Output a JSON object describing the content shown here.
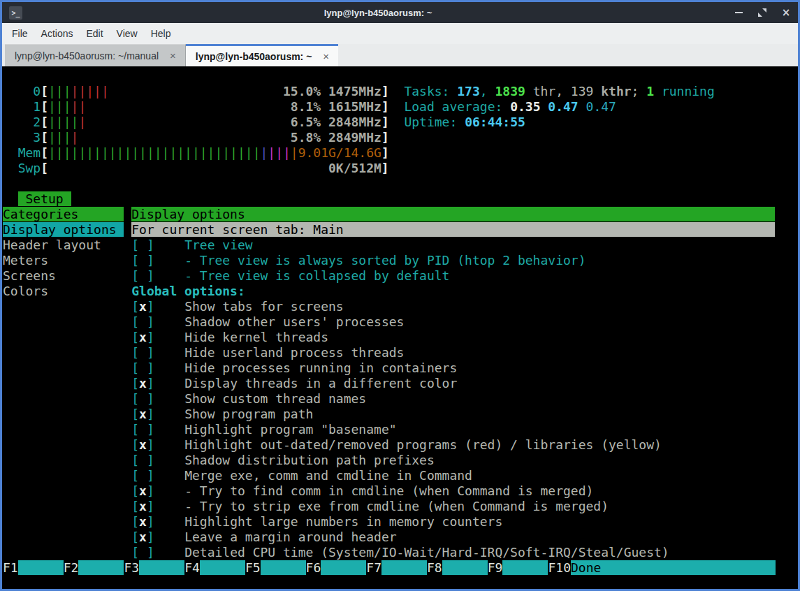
{
  "window": {
    "title": "lynp@lyn-b450aorusm: ~",
    "buttons": [
      "minimize",
      "restore",
      "close"
    ]
  },
  "glyphs": {
    "terminal_icon": ">_",
    "close": "×"
  },
  "menu": {
    "items": [
      "File",
      "Actions",
      "Edit",
      "View",
      "Help"
    ]
  },
  "tabs": [
    {
      "label": "lynp@lyn-b450aorusm: ~/manual",
      "active": false
    },
    {
      "label": "lynp@lyn-b450aorusm: ~",
      "active": true
    }
  ],
  "htop": {
    "cpus": [
      {
        "id": "0",
        "bars_green": 3,
        "bars_red": 5,
        "text": "15.0% 1475MHz"
      },
      {
        "id": "1",
        "bars_green": 3,
        "bars_red": 2,
        "text": "8.1% 1615MHz"
      },
      {
        "id": "2",
        "bars_green": 4,
        "bars_red": 1,
        "text": "6.5% 2848MHz"
      },
      {
        "id": "3",
        "bars_green": 3,
        "bars_red": 1,
        "text": "5.8% 2849MHz"
      }
    ],
    "mem": {
      "label": "Mem",
      "green": 28,
      "blue": 1,
      "magenta": 3,
      "orange": 1,
      "text": "9.01G/14.6G"
    },
    "swp": {
      "label": "Swp",
      "text": "0K/512M"
    },
    "tasks": {
      "label": "Tasks: ",
      "count": "173",
      "comma": ", ",
      "threads": "1839",
      "thr": " thr, ",
      "kthreads": "139",
      "kthr": " kthr",
      "semi": "; ",
      "running": "1",
      "running_label": " running"
    },
    "load": {
      "label": "Load average: ",
      "one": "0.35",
      "five": "0.47",
      "fifteen": "0.47"
    },
    "uptime": {
      "label": "Uptime: ",
      "value": "06:44:55"
    },
    "setup_title": " Setup ",
    "categories_header": "Categories",
    "categories": [
      "Display options",
      "Header layout",
      "Meters",
      "Screens",
      "Colors"
    ],
    "selected_category": "Display options",
    "panel_header": "Display options",
    "panel_subheader": "For current screen tab: Main",
    "screen_options": [
      {
        "checked": false,
        "label": "Tree view"
      },
      {
        "checked": false,
        "label": "- Tree view is always sorted by PID (htop 2 behavior)"
      },
      {
        "checked": false,
        "label": "- Tree view is collapsed by default"
      }
    ],
    "global_header": "Global options:",
    "global_options": [
      {
        "checked": true,
        "label": "Show tabs for screens"
      },
      {
        "checked": false,
        "label": "Shadow other users' processes"
      },
      {
        "checked": true,
        "label": "Hide kernel threads"
      },
      {
        "checked": false,
        "label": "Hide userland process threads"
      },
      {
        "checked": false,
        "label": "Hide processes running in containers"
      },
      {
        "checked": true,
        "label": "Display threads in a different color"
      },
      {
        "checked": false,
        "label": "Show custom thread names"
      },
      {
        "checked": true,
        "label": "Show program path"
      },
      {
        "checked": false,
        "label": "Highlight program \"basename\""
      },
      {
        "checked": true,
        "label": "Highlight out-dated/removed programs (red) / libraries (yellow)"
      },
      {
        "checked": false,
        "label": "Shadow distribution path prefixes"
      },
      {
        "checked": false,
        "label": "Merge exe, comm and cmdline in Command"
      },
      {
        "checked": true,
        "label": "- Try to find comm in cmdline (when Command is merged)"
      },
      {
        "checked": true,
        "label": "- Try to strip exe from cmdline (when Command is merged)"
      },
      {
        "checked": true,
        "label": "Highlight large numbers in memory counters"
      },
      {
        "checked": true,
        "label": "Leave a margin around header"
      },
      {
        "checked": false,
        "label": "Detailed CPU time (System/IO-Wait/Hard-IRQ/Soft-IRQ/Steal/Guest)"
      }
    ],
    "fkeys": [
      {
        "key": "F1",
        "label": ""
      },
      {
        "key": "F2",
        "label": ""
      },
      {
        "key": "F3",
        "label": ""
      },
      {
        "key": "F4",
        "label": ""
      },
      {
        "key": "F5",
        "label": ""
      },
      {
        "key": "F6",
        "label": ""
      },
      {
        "key": "F7",
        "label": ""
      },
      {
        "key": "F8",
        "label": ""
      },
      {
        "key": "F9",
        "label": ""
      },
      {
        "key": "F10",
        "label": "Done"
      }
    ]
  }
}
